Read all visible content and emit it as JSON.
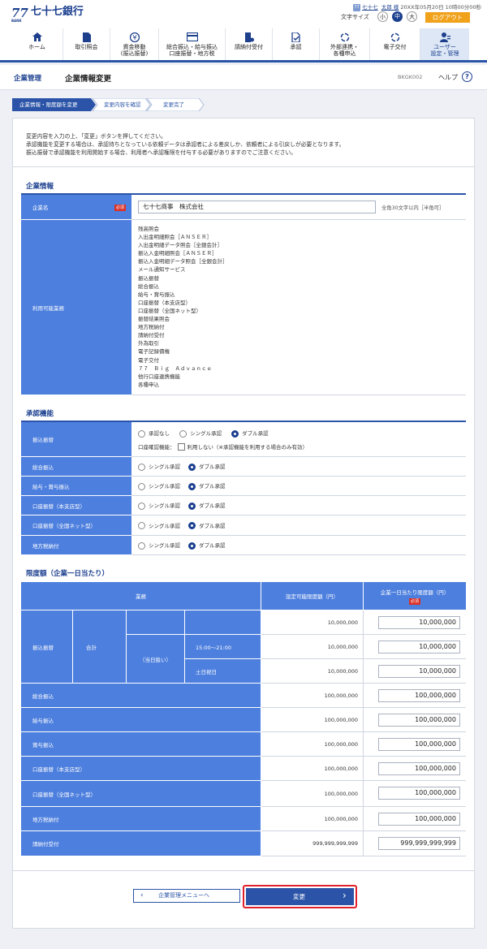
{
  "header": {
    "bank_mark": "77",
    "bank_mark_sub": "BANK",
    "bank_name": "七十七銀行",
    "user_icon": "77",
    "user_company": "七十七",
    "user_name": "太郎 様",
    "login_datetime": "20XX年05月20日 10時00分00秒",
    "font_size_label": "文字サイズ",
    "font_small": "小",
    "font_medium": "中",
    "font_large": "大",
    "logout": "ログアウト"
  },
  "nav": [
    {
      "icon": "home-icon",
      "label1": "ホーム",
      "label2": ""
    },
    {
      "icon": "document-icon",
      "label1": "取引照会",
      "label2": ""
    },
    {
      "icon": "yen-transfer-icon",
      "label1": "資金移動",
      "label2": "(振込振替)"
    },
    {
      "icon": "card-icon",
      "label1": "総合振込・給与振込",
      "label2": "口座振替・地方税"
    },
    {
      "icon": "person-pay-icon",
      "label1": "請納付受付",
      "label2": ""
    },
    {
      "icon": "approve-icon",
      "label1": "承認",
      "label2": ""
    },
    {
      "icon": "link-icon",
      "label1": "外部連携・",
      "label2": "各種申込"
    },
    {
      "icon": "link2-icon",
      "label1": "電子交付",
      "label2": ""
    },
    {
      "icon": "user-settings-icon",
      "label1": "ユーザー",
      "label2": "設定・管理"
    }
  ],
  "page": {
    "category": "企業管理",
    "title": "企業情報変更",
    "screen_id": "BKGK002",
    "help": "ヘルプ",
    "help_icon": "?"
  },
  "steps": [
    "企業情報・限度額を変更",
    "変更内容を確認",
    "変更完了"
  ],
  "instructions": [
    "変更内容を入力の上、「変更」ボタンを押してください。",
    "承認機能を変更する場合は、承認待ちとなっている依頼データは承認者による差戻しか、依頼者による引戻しが必要となります。",
    "振込振替で承認機能を利用開始する場合、利用者へ承認権限を付与する必要がありますのでご注意ください。"
  ],
  "company_info": {
    "section_title": "企業情報",
    "name_label": "企業名",
    "required": "必須",
    "name_value": "七十七商事　株式会社",
    "name_hint": "全角30文字以内［半角可］",
    "services_label": "利用可能業務",
    "services": [
      "残高照会",
      "入出金明細照会［ＡＮＳＥＲ］",
      "入出金明細データ照会［全銀会計］",
      "振込入金明細照会［ＡＮＳＥＲ］",
      "振込入金明細データ照会［全銀会計］",
      "メール通知サービス",
      "振込振替",
      "総合振込",
      "給与・賞与振込",
      "口座振替（本支店型）",
      "口座振替（全国ネット型）",
      "振替結果照会",
      "地方税納付",
      "請納付受付",
      "外為取引",
      "電子記録債権",
      "電子交付",
      "７７　Ｂｉｇ　Ａｄｖａｎｃｅ",
      "他行口座連携機能",
      "各種申込"
    ]
  },
  "approval": {
    "section_title": "承認機能",
    "opt_none": "承認なし",
    "opt_single": "シングル承認",
    "opt_double": "ダブル承認",
    "confirm_label": "口座確認機能：",
    "confirm_option": "利用しない（※承認機能を利用する場合のみ有効）",
    "rows": [
      "振込振替",
      "総合振込",
      "給与・賞与振込",
      "口座振替（本支店型）",
      "口座振替（全国ネット型）",
      "地方税納付"
    ]
  },
  "limits": {
    "section_title": "限度額（企業一日当たり）",
    "col_service": "業務",
    "col_max": "設定可能限度額（円）",
    "col_limit": "企業一日当たり限度額（円）",
    "required": "必須",
    "transfer_label": "振込振替",
    "total_label": "合計",
    "same_day_label": "（当日扱い）",
    "time_label": "15:00～21:00",
    "holiday_label": "土日祝日",
    "transfer_rows": [
      {
        "max": "10,000,000",
        "value": "10,000,000"
      },
      {
        "max": "10,000,000",
        "value": "10,000,000"
      },
      {
        "max": "10,000,000",
        "value": "10,000,000"
      }
    ],
    "rows": [
      {
        "label": "総合振込",
        "max": "100,000,000",
        "value": "100,000,000"
      },
      {
        "label": "給与振込",
        "max": "100,000,000",
        "value": "100,000,000"
      },
      {
        "label": "賞与振込",
        "max": "100,000,000",
        "value": "100,000,000"
      },
      {
        "label": "口座振替（本支店型）",
        "max": "100,000,000",
        "value": "100,000,000"
      },
      {
        "label": "口座振替（全国ネット型）",
        "max": "100,000,000",
        "value": "100,000,000"
      },
      {
        "label": "地方税納付",
        "max": "100,000,000",
        "value": "100,000,000"
      },
      {
        "label": "請納付受付",
        "max": "999,999,999,999",
        "value": "999,999,999,999"
      }
    ]
  },
  "buttons": {
    "back": "企業管理メニューへ",
    "submit": "変更"
  },
  "colors": {
    "brand": "#1b3f8f",
    "label_bg": "#4d7fde",
    "logout": "#f0a21b",
    "highlight": "#e0212b"
  }
}
